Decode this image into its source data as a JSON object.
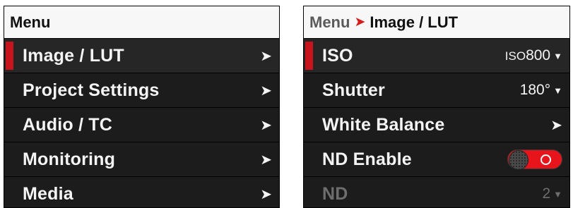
{
  "left_panel": {
    "header": "Menu",
    "items": [
      {
        "label": "Image / LUT",
        "selected": true
      },
      {
        "label": "Project Settings"
      },
      {
        "label": "Audio / TC"
      },
      {
        "label": "Monitoring"
      },
      {
        "label": "Media"
      }
    ]
  },
  "right_panel": {
    "breadcrumb": {
      "parent": "Menu",
      "separator": "➤",
      "current": "Image / LUT"
    },
    "items": [
      {
        "label": "ISO",
        "value_prefix": "ISO",
        "value": "800",
        "selected": true
      },
      {
        "label": "Shutter",
        "value": "180°"
      },
      {
        "label": "White Balance"
      },
      {
        "label": "ND Enable",
        "toggle": "on"
      },
      {
        "label": "ND",
        "value": "2",
        "disabled": true
      }
    ]
  },
  "icons": {
    "chevron": "›",
    "caret": "▼"
  },
  "colors": {
    "accent": "#c8141c",
    "toggle_on": "#e8141c",
    "panel_bg": "#1c1c1c",
    "header_bg": "#f7f7f7"
  }
}
